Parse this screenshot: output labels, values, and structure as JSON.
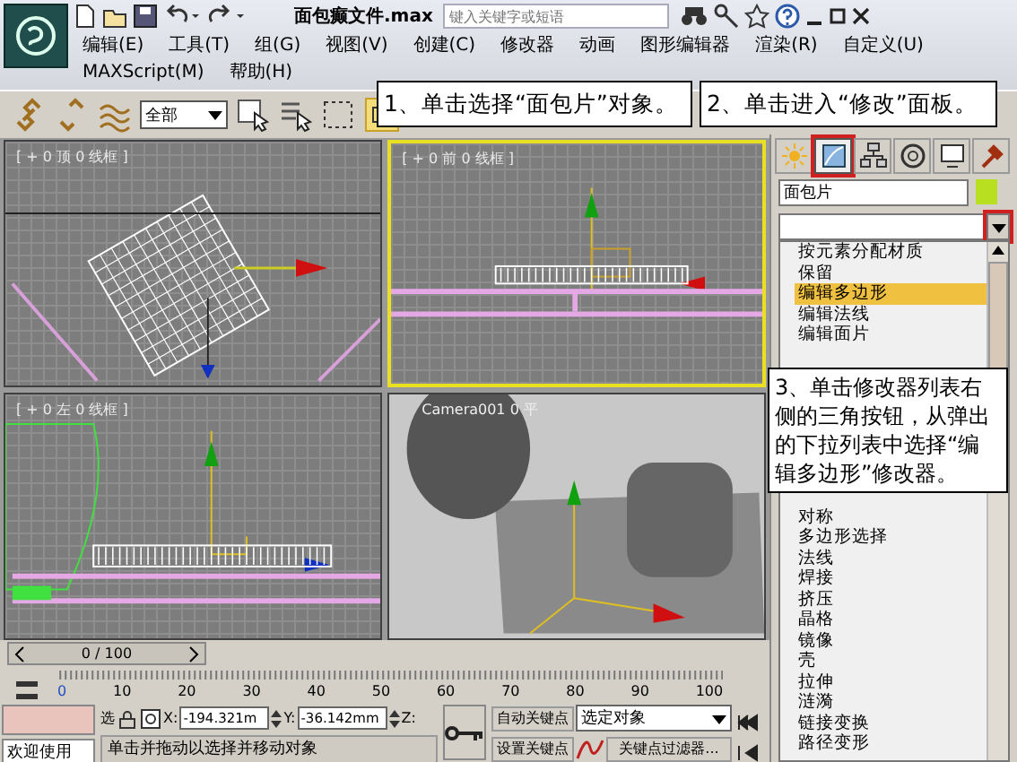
{
  "app": {
    "title": "面包癫文件.max",
    "search": {
      "placeholder": "键入关键字或短语"
    }
  },
  "menu": [
    {
      "label": "编辑(E)"
    },
    {
      "label": "工具(T)"
    },
    {
      "label": "组(G)"
    },
    {
      "label": "视图(V)"
    },
    {
      "label": "创建(C)"
    },
    {
      "label": "修改器"
    },
    {
      "label": "动画"
    },
    {
      "label": "图形编辑器"
    },
    {
      "label": "渲染(R)"
    },
    {
      "label": "自定义(U)"
    },
    {
      "label": "MAXScript(M)"
    },
    {
      "label": "帮助(H)"
    }
  ],
  "toolbar": {
    "selection_filter": "全部"
  },
  "callouts": [
    {
      "text": "1、单击选择“面包片”对象。"
    },
    {
      "text": "2、单击进入“修改”面板。"
    },
    {
      "text": "3、单击修改器列表右侧的三角按钮，从弹出的下拉列表中选择“编辑多边形”修改器。"
    }
  ],
  "viewports": [
    {
      "kind": "top",
      "label": "[ + 0 顶 0 线框 ]",
      "active": false
    },
    {
      "kind": "front",
      "label": "[ + 0 前 0 线框 ]",
      "active": true
    },
    {
      "kind": "left",
      "label": "[ + 0 左 0 线框 ]",
      "active": false
    },
    {
      "kind": "camera",
      "label": "Camera001 0 平",
      "active": false
    }
  ],
  "command_panel": {
    "tabs": [
      {
        "kind": "create",
        "selected": false,
        "highlighted": false
      },
      {
        "kind": "modify",
        "selected": true,
        "highlighted": true
      },
      {
        "kind": "hierarchy",
        "selected": false,
        "highlighted": false
      },
      {
        "kind": "motion",
        "selected": false,
        "highlighted": false
      },
      {
        "kind": "display",
        "selected": false,
        "highlighted": false
      },
      {
        "kind": "utilities",
        "selected": false,
        "highlighted": false
      }
    ],
    "object_name": "面包片",
    "modifier_list": {
      "expanded": true,
      "arrow_highlighted": true,
      "items": [
        {
          "label": "按元素分配材质",
          "selected": false
        },
        {
          "label": "保留",
          "selected": false
        },
        {
          "label": "编辑多边形",
          "selected": true
        },
        {
          "label": "编辑法线",
          "selected": false
        },
        {
          "label": "编辑面片",
          "selected": false
        }
      ],
      "items_below_callout": [
        {
          "label": "对称",
          "selected": false
        },
        {
          "label": "多边形选择",
          "selected": false
        },
        {
          "label": "法线",
          "selected": false
        },
        {
          "label": "焊接",
          "selected": false
        },
        {
          "label": "挤压",
          "selected": false
        },
        {
          "label": "晶格",
          "selected": false
        },
        {
          "label": "镜像",
          "selected": false
        },
        {
          "label": "壳",
          "selected": false
        },
        {
          "label": "拉伸",
          "selected": false
        },
        {
          "label": "涟漪",
          "selected": false
        },
        {
          "label": "链接变换",
          "selected": false
        },
        {
          "label": "路径变形",
          "selected": false
        }
      ]
    }
  },
  "timeline": {
    "frame": "0 / 100",
    "ticks": [
      "0",
      "10",
      "20",
      "30",
      "40",
      "50",
      "60",
      "70",
      "80",
      "90",
      "100"
    ]
  },
  "status": {
    "welcome": "欢迎使用",
    "select_label": "选",
    "x_label": "X:",
    "x": "-194.321m",
    "y_label": "Y:",
    "y": "-36.142mm",
    "z_label": "Z:",
    "prompt": "单击并拖动以选择并移动对象",
    "auto_key": "自动关键点",
    "key_mode": "选定对象",
    "set_key": "设置关键点",
    "key_filters": "关键点过滤器..."
  }
}
